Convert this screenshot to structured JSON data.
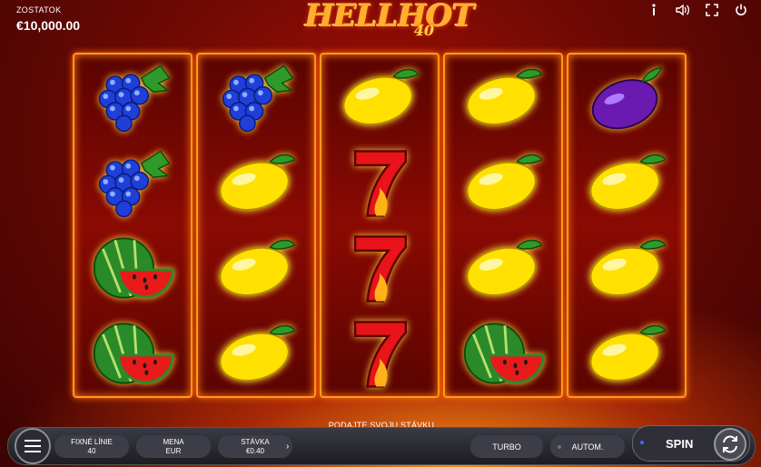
{
  "balance": {
    "label": "ZOSTATOK",
    "value": "€10,000.00"
  },
  "logo": {
    "word": "HELLHOT",
    "number": "40"
  },
  "top_icons": [
    "info-icon",
    "sound-icon",
    "fullscreen-icon",
    "power-icon"
  ],
  "reels": [
    [
      "grapes",
      "grapes",
      "watermelon",
      "watermelon"
    ],
    [
      "grapes",
      "lemon",
      "lemon",
      "lemon"
    ],
    [
      "lemon",
      "seven",
      "seven",
      "seven"
    ],
    [
      "lemon",
      "lemon",
      "lemon",
      "watermelon"
    ],
    [
      "plum",
      "lemon",
      "lemon",
      "lemon"
    ]
  ],
  "message": "PODAJTE SVOJU STÁVKU",
  "controls": {
    "lines_label": "FIXNÉ LÍNIE",
    "lines_value": "40",
    "currency_label": "MENA",
    "currency_value": "EUR",
    "bet_label": "STÁVKA",
    "bet_value": "€0.40",
    "turbo_label": "TURBO",
    "auto_label": "AUTOM.",
    "spin_label": "SPIN"
  },
  "colors": {
    "accent": "#ff9a1a",
    "background": "#7a0a04",
    "bar": "#2b2b33"
  }
}
